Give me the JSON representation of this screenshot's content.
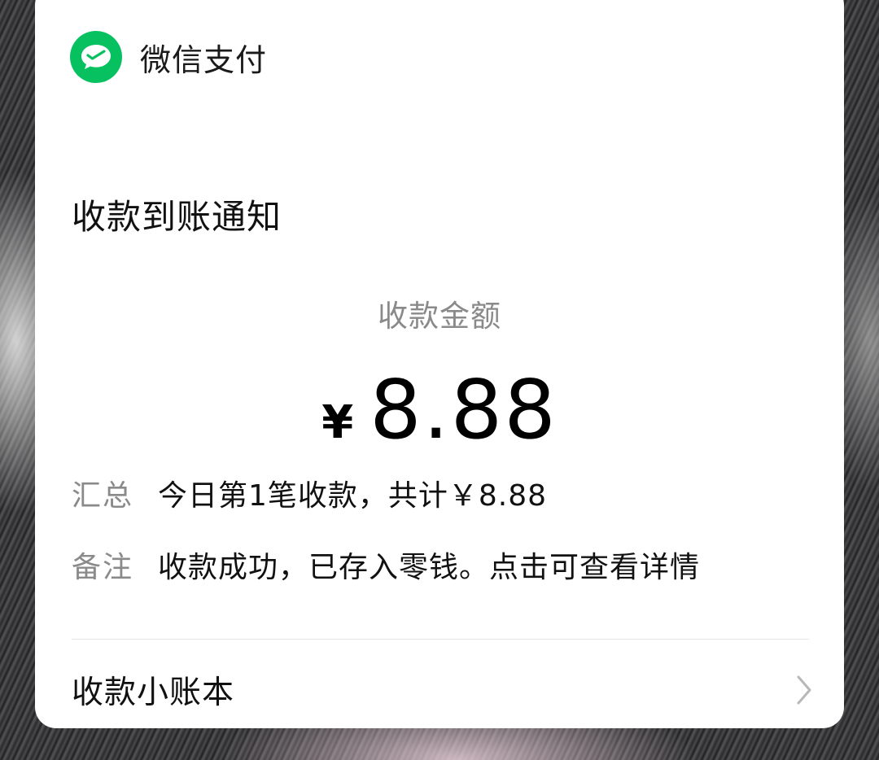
{
  "colors": {
    "wechat_green": "#07c160",
    "text_primary": "#111111",
    "text_secondary": "#8a8a8a",
    "card_background": "#ffffff"
  },
  "header": {
    "icon": "wechat-pay-logo-icon",
    "app_name": "微信支付"
  },
  "notification": {
    "title": "收款到账通知",
    "amount_label": "收款金额",
    "currency_symbol": "¥",
    "amount": "8.88"
  },
  "details": [
    {
      "key": "汇总",
      "value": "今日第1笔收款，共计￥8.88"
    },
    {
      "key": "备注",
      "value": "收款成功，已存入零钱。点击可查看详情"
    }
  ],
  "footer": {
    "label": "收款小账本",
    "icon": "chevron-right-icon"
  }
}
